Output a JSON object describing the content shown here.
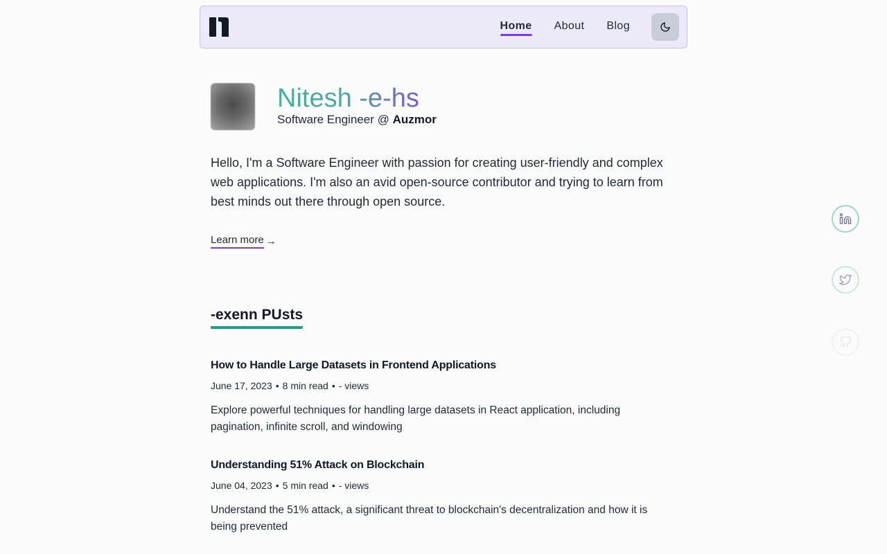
{
  "nav": {
    "logo_icon": "brand-logo-icon",
    "links": [
      {
        "label": "Home",
        "active": true
      },
      {
        "label": "About",
        "active": false
      },
      {
        "label": "Blog",
        "active": false
      }
    ],
    "theme_toggle_icon": "moon-icon"
  },
  "hero": {
    "name": "Nitesh -e-hs",
    "role_prefix": "Software Engineer @ ",
    "company": "Auzmor",
    "bio": "Hello, I'm a Software Engineer with passion for creating user-friendly and complex web applications. I'm also an avid open-source contributor and trying to learn from best minds out there through open source.",
    "learn_more": "Learn more",
    "learn_more_arrow": "→"
  },
  "posts_section": {
    "title": "-exenn PUsts",
    "posts": [
      {
        "title": "How to Handle Large Datasets in Frontend Applications",
        "date": "June 17, 2023",
        "read_time": "8 min read",
        "views": "- views",
        "description": "Explore powerful techniques for handling large datasets in React application, including pagination, infinite scroll, and windowing"
      },
      {
        "title": "Understanding 51% Attack on Blockchain",
        "date": "June 04, 2023",
        "read_time": "5 min read",
        "views": "- views",
        "description": "Understand the 51% attack, a significant threat to blockchain's decentralization and how it is being prevented"
      }
    ],
    "separator": "•"
  },
  "social": [
    {
      "icon": "linkedin-icon"
    },
    {
      "icon": "twitter-icon"
    },
    {
      "icon": "github-icon"
    }
  ],
  "colors": {
    "accent_purple": "#7c3aed",
    "accent_teal": "#14a38b",
    "nav_bg": "#ece9f8"
  }
}
